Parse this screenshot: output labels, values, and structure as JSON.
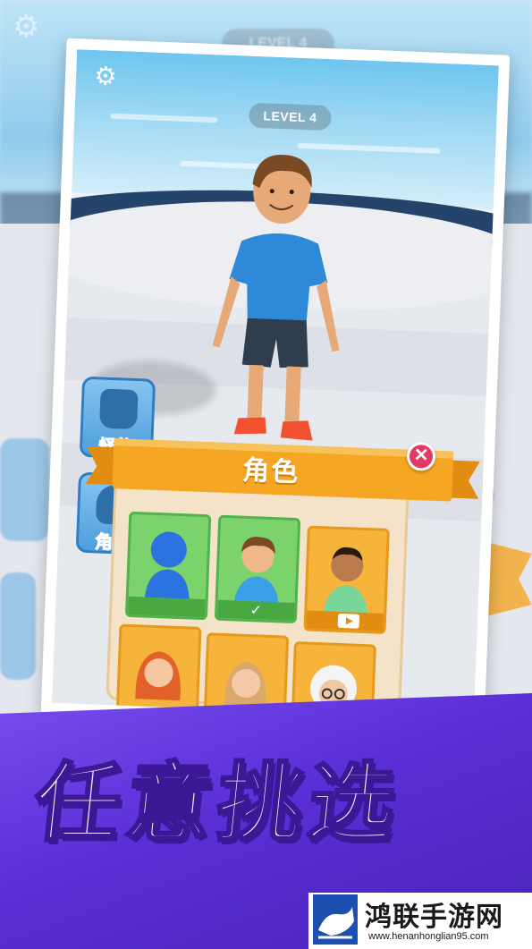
{
  "hud": {
    "level_label": "LEVEL 4",
    "background_level_label": "LEVEL 4",
    "settings_icon": "gear-icon"
  },
  "side_menu": {
    "monster_label": "怪物",
    "character_label": "角色"
  },
  "panel": {
    "title": "角色",
    "close_symbol": "✕",
    "cells": [
      {
        "kind": "blue-mannequin",
        "color": "green",
        "state": "unlocked"
      },
      {
        "kind": "boy-blue-shirt",
        "color": "green",
        "state": "selected",
        "badge": "✓"
      },
      {
        "kind": "man-green-shirt",
        "color": "orange",
        "state": "watch-video"
      },
      {
        "kind": "redhead-girl",
        "color": "orange",
        "state": "locked"
      },
      {
        "kind": "blonde-woman",
        "color": "orange",
        "state": "locked"
      },
      {
        "kind": "old-scientist",
        "color": "orange",
        "state": "locked"
      }
    ]
  },
  "banner": {
    "tagline": "任意挑选"
  },
  "watermark": {
    "name": "鸿联手游网",
    "url": "www.henanhonglian95.com"
  },
  "colors": {
    "banner_purple": "#5a2fd6",
    "panel_orange": "#f6b43a",
    "panel_green": "#7cd36b",
    "close_red": "#e13a64",
    "side_blue": "#4f9edc"
  }
}
